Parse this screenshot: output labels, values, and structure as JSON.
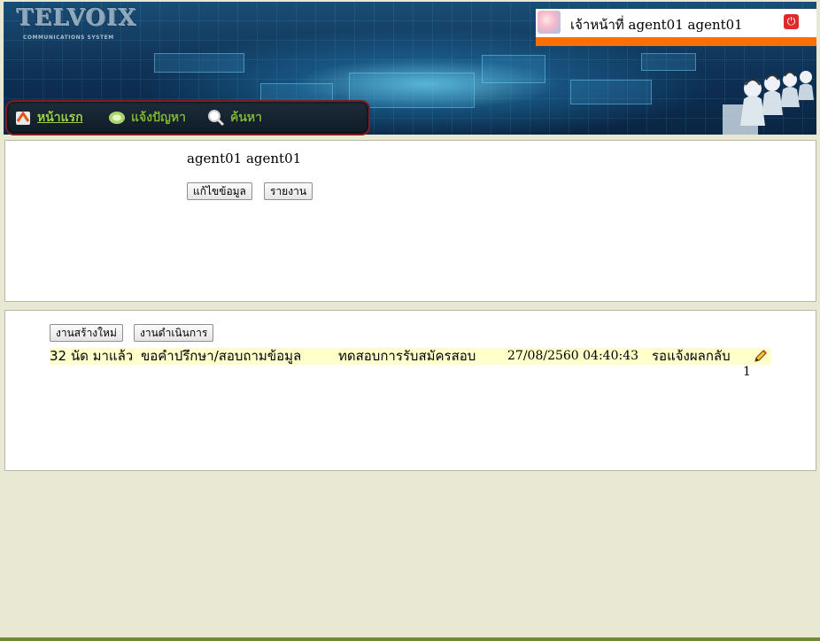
{
  "header": {
    "logo_text": "TELVOIX",
    "logo_subtitle": "COMMUNICATIONS SYSTEM",
    "user_label": "เจ้าหน้าที่ agent01 agent01",
    "power_icon": "power-icon",
    "accent_color": "#ff6e00"
  },
  "nav": {
    "items": [
      {
        "label": "หน้าแรก",
        "icon": "home-icon"
      },
      {
        "label": "แจ้งปัญหา",
        "icon": "report-problem-icon"
      },
      {
        "label": "ค้นหา",
        "icon": "search-icon"
      }
    ]
  },
  "profile": {
    "name": "agent01 agent01",
    "edit_button": "แก้ไขข้อมูล",
    "report_button": "รายงาน"
  },
  "tasks": {
    "new_tasks_button": "งานสร้างใหม่",
    "in_progress_button": "งานดำเนินการ",
    "rows": [
      {
        "age": "32 นัด มาแล้ว",
        "category": "ขอคำปรึกษา/สอบถามข้อมูล",
        "subject": "ทดสอบการรับสมัครสอบ",
        "datetime": "27/08/2560 04:40:43",
        "status": "รอแจ้งผลกลับ",
        "action_icon": "edit-pencil-icon"
      }
    ],
    "page": "1"
  }
}
